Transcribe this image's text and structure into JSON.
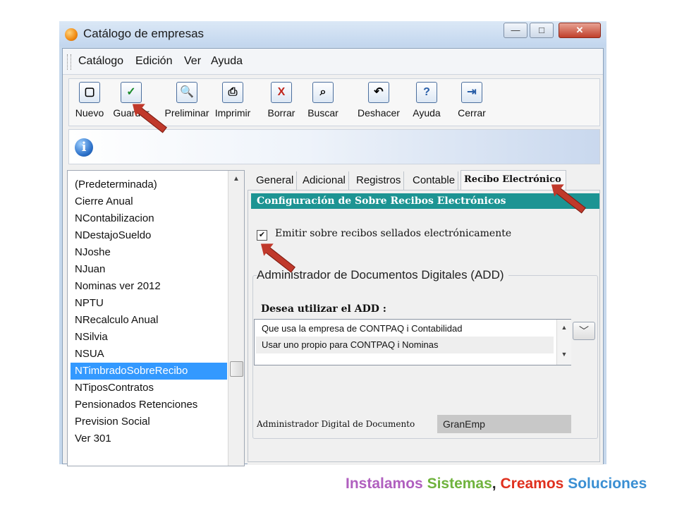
{
  "window": {
    "title": "Catálogo de empresas",
    "controls": {
      "minimize": "—",
      "maximize": "□",
      "close": "✕"
    }
  },
  "menu": {
    "items": [
      "Catálogo",
      "Edición",
      "Ver",
      "Ayuda"
    ]
  },
  "toolbar": {
    "buttons": [
      {
        "label": "Nuevo",
        "icon": "new-document-icon",
        "glyph": "▢"
      },
      {
        "label": "Guardar",
        "icon": "check-icon",
        "glyph": "✓",
        "color": "#1a8a2a"
      },
      {
        "label": "Preliminar",
        "icon": "preview-icon",
        "glyph": "🔍"
      },
      {
        "label": "Imprimir",
        "icon": "printer-icon",
        "glyph": "⎙"
      },
      {
        "label": "Borrar",
        "icon": "delete-icon",
        "glyph": "X",
        "color": "#c0261c"
      },
      {
        "label": "Buscar",
        "icon": "binoculars-icon",
        "glyph": "⌕"
      },
      {
        "label": "Deshacer",
        "icon": "undo-icon",
        "glyph": "↶"
      },
      {
        "label": "Ayuda",
        "icon": "help-icon",
        "glyph": "?"
      },
      {
        "label": "Cerrar",
        "icon": "exit-icon",
        "glyph": "⇥"
      }
    ]
  },
  "info": {
    "icon": "info-icon",
    "glyph": "i"
  },
  "company_list": {
    "items": [
      "(Predeterminada)",
      "Cierre Anual",
      "NContabilizacion",
      "NDestajoSueldo",
      "NJoshe",
      "NJuan",
      "Nominas ver 2012",
      "NPTU",
      "NRecalculo Anual",
      "NSilvia",
      "NSUA",
      "NTimbradoSobreRecibo",
      "NTiposContratos",
      "Pensionados Retenciones",
      "Prevision Social",
      "Ver 301"
    ],
    "selected_index": 11
  },
  "tabs": [
    "General",
    "Adicional",
    "Registros",
    "Contable",
    "Recibo Electrónico"
  ],
  "panel": {
    "section_header": "Configuración de Sobre Recibos Electrónicos",
    "checkbox_label": "Emitir sobre recibos sellados electrónicamente",
    "checkbox_checked": true,
    "group_title": "Administrador de Documentos Digitales (ADD)",
    "question": "Desea utilizar el ADD :",
    "options": [
      "Que usa la empresa de CONTPAQ i Contabilidad",
      "Usar uno propio para CONTPAQ i Nominas"
    ],
    "digital_label": "Administrador Digital de Documento",
    "digital_value": "GranEmp"
  },
  "tagline": {
    "w1": "Instalamos",
    "w2": "Sistemas",
    "comma": ",",
    "w3": "Creamos",
    "w4": "Soluciones"
  },
  "colors": {
    "accent_header": "#1d9493",
    "selection": "#3399ff",
    "arrow": "#c0392b"
  }
}
